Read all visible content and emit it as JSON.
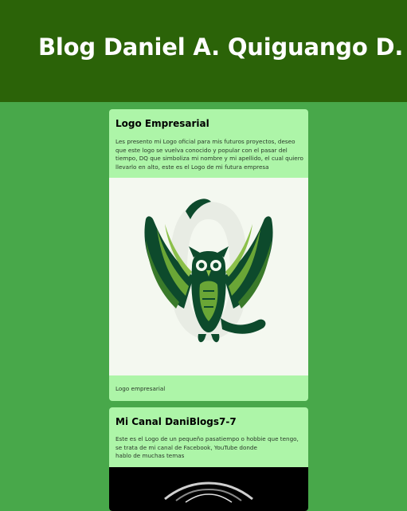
{
  "header": {
    "title": "Blog Daniel A. Quiguango D."
  },
  "posts": [
    {
      "title": "Logo Empresarial",
      "body": "Les presento mi Logo oficial para mis futuros proyectos, deseo que este logo se vuelva conocido y popular con el pasar del tiempo, DQ que simboliza mi nombre y mi apellido, el cual quiero llevarlo en alto, este es el Logo de mi futura empresa",
      "image_icon": "owl-dq-logo-icon",
      "caption": "Logo empresarial"
    },
    {
      "title": "Mi Canal DaniBlogs7-7",
      "body": "Este es el Logo de un pequeño pasatiempo o hobbie que tengo, se trata de mi canal de Facebook, YouTube donde\nhablo de muchas temas",
      "image_icon": "channel-logo-icon"
    }
  ],
  "colors": {
    "header_bg": "#2b6308",
    "page_bg": "#48a84a",
    "card_bg": "#adf5a8",
    "logo_dark": "#0d4a2c",
    "logo_accent": "#5a9a2a"
  }
}
